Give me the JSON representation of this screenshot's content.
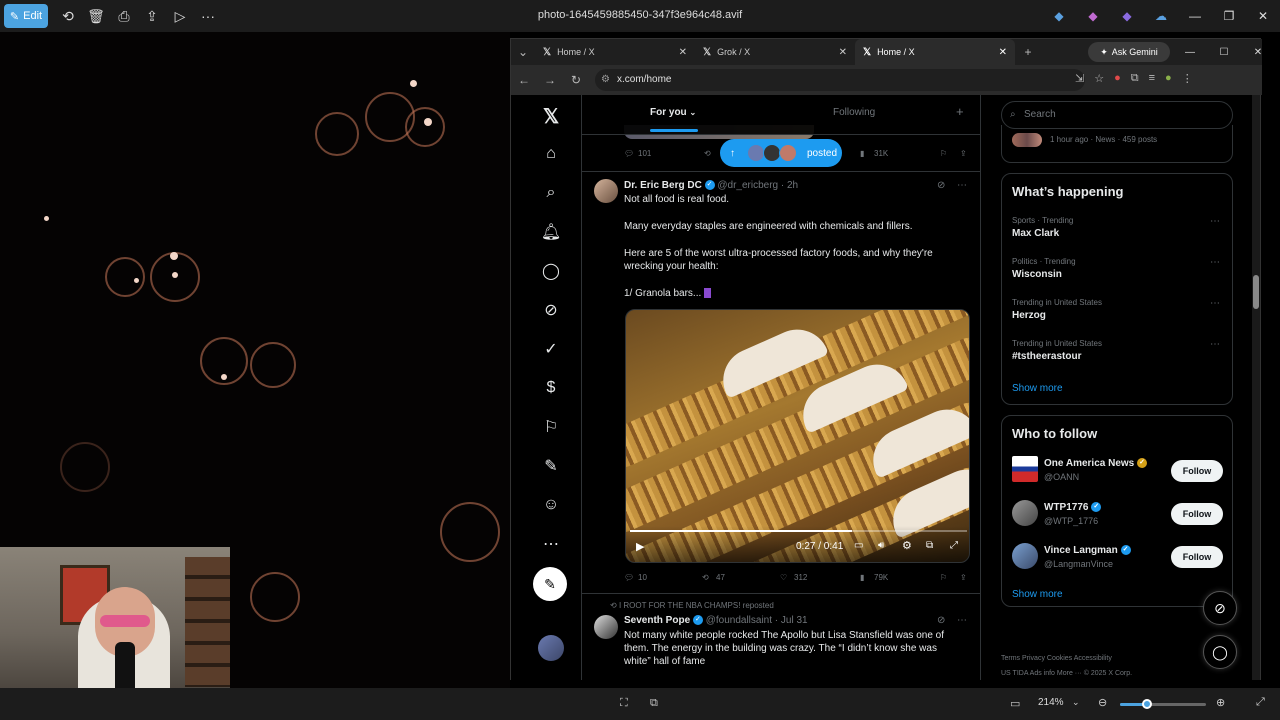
{
  "viewer": {
    "edit_label": "Edit",
    "title": "photo-1645459885450-347f3e964c48.avif",
    "zoom": "214%"
  },
  "browser": {
    "tabs": [
      {
        "label": "Home / X"
      },
      {
        "label": "Grok / X"
      },
      {
        "label": "Home / X"
      }
    ],
    "gemini_label": "Ask Gemini",
    "url": "x.com/home"
  },
  "feed": {
    "tab_for_you": "For you",
    "tab_following": "Following",
    "posted_label": "posted",
    "prev_actions": {
      "replies": "101",
      "views": "31K"
    },
    "tweet1": {
      "name": "Dr. Eric Berg DC",
      "handle": "@dr_ericberg",
      "time": "· 2h",
      "line1": "Not all food is real food.",
      "line2": "Many everyday staples are engineered with chemicals and fillers.",
      "line3": "Here are 5 of the worst ultra-processed factory foods, and why they're",
      "line4": "wrecking your health:",
      "line5": "1/ Granola bars...",
      "video_time": "0:27 / 0:41",
      "video_progress": 0.66,
      "replies": "10",
      "reposts": "47",
      "likes": "312",
      "views": "79K"
    },
    "tweet2": {
      "repost_context": "I ROOT FOR THE NBA CHAMPS! reposted",
      "name": "Seventh Pope",
      "handle": "@foundallsaint",
      "time": "· Jul 31",
      "line1": "Not many white people rocked The Apollo but Lisa Stansfield was one of",
      "line2": "them. The energy in the building was crazy. The “I didn’t know she was",
      "line3": "white” hall of fame"
    }
  },
  "sidebar": {
    "search_placeholder": "Search",
    "news_meta": "1 hour ago · News · 459 posts",
    "whats_happening": "What’s happening",
    "trends": [
      {
        "meta": "Sports · Trending",
        "name": "Max Clark"
      },
      {
        "meta": "Politics · Trending",
        "name": "Wisconsin"
      },
      {
        "meta": "Trending in United States",
        "name": "Herzog"
      },
      {
        "meta": "Trending in United States",
        "name": "#tstheerastour"
      }
    ],
    "show_more": "Show more",
    "who_to_follow": "Who to follow",
    "follow": [
      {
        "name": "One America News",
        "handle": "@OANN",
        "button": "Follow"
      },
      {
        "name": "WTP1776",
        "handle": "@WTP_1776",
        "button": "Follow"
      },
      {
        "name": "Vince Langman",
        "handle": "@LangmanVince",
        "button": "Follow"
      }
    ],
    "show_more_2": "Show more",
    "footer1": "Terms   Privacy   Cookies   Accessibility",
    "footer2": "US TIDA   Ads info   More ···   © 2025 X Corp."
  },
  "colors": {
    "accent": "#1d9bf0",
    "background": "#000000",
    "viewer_accent": "#4ca3e0"
  }
}
